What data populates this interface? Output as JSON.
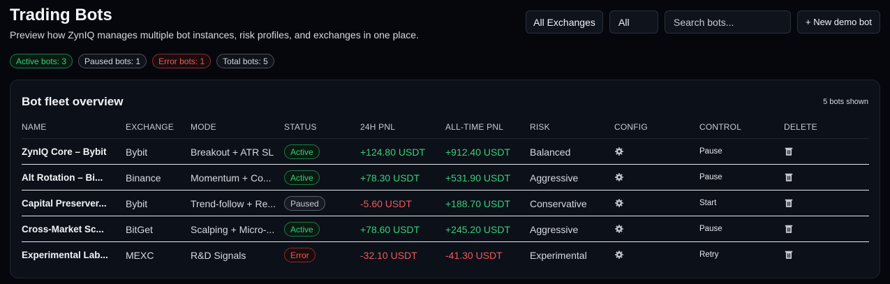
{
  "header": {
    "title": "Trading Bots",
    "subtitle": "Preview how ZynIQ manages multiple bot instances, risk profiles, and exchanges in one place."
  },
  "toolbar": {
    "exchange_filter": "All Exchanges",
    "status_filter": "All",
    "search_placeholder": "Search bots...",
    "new_button": "+ New demo bot"
  },
  "summary": {
    "active": "Active bots: 3",
    "paused": "Paused bots: 1",
    "error": "Error bots: 1",
    "total": "Total bots: 5"
  },
  "card": {
    "title": "Bot fleet overview",
    "count": "5 bots shown"
  },
  "columns": [
    "NAME",
    "EXCHANGE",
    "MODE",
    "STATUS",
    "24H PNL",
    "ALL-TIME PNL",
    "RISK",
    "CONFIG",
    "CONTROL",
    "DELETE"
  ],
  "bots": [
    {
      "name": "ZynIQ Core – Bybit",
      "exchange": "Bybit",
      "mode": "Breakout + ATR SL",
      "status": "Active",
      "pnl24": "+124.80 USDT",
      "pnlall": "+912.40 USDT",
      "risk": "Balanced",
      "control": "Pause"
    },
    {
      "name": "Alt Rotation – Bi...",
      "exchange": "Binance",
      "mode": "Momentum + Co...",
      "status": "Active",
      "pnl24": "+78.30 USDT",
      "pnlall": "+531.90 USDT",
      "risk": "Aggressive",
      "control": "Pause"
    },
    {
      "name": "Capital Preserver...",
      "exchange": "Bybit",
      "mode": "Trend-follow + Re...",
      "status": "Paused",
      "pnl24": "-5.60 USDT",
      "pnlall": "+188.70 USDT",
      "risk": "Conservative",
      "control": "Start"
    },
    {
      "name": "Cross-Market Sc...",
      "exchange": "BitGet",
      "mode": "Scalping + Micro-...",
      "status": "Active",
      "pnl24": "+78.60 USDT",
      "pnlall": "+245.20 USDT",
      "risk": "Aggressive",
      "control": "Pause"
    },
    {
      "name": "Experimental Lab...",
      "exchange": "MEXC",
      "mode": "R&D Signals",
      "status": "Error",
      "pnl24": "-32.10 USDT",
      "pnlall": "-41.30 USDT",
      "risk": "Experimental",
      "control": "Retry"
    }
  ],
  "icons": {
    "config": "gear-icon",
    "delete": "trash-icon"
  },
  "colors": {
    "positive": "#37d07a",
    "negative": "#ef5a5a",
    "background": "#05070d"
  }
}
